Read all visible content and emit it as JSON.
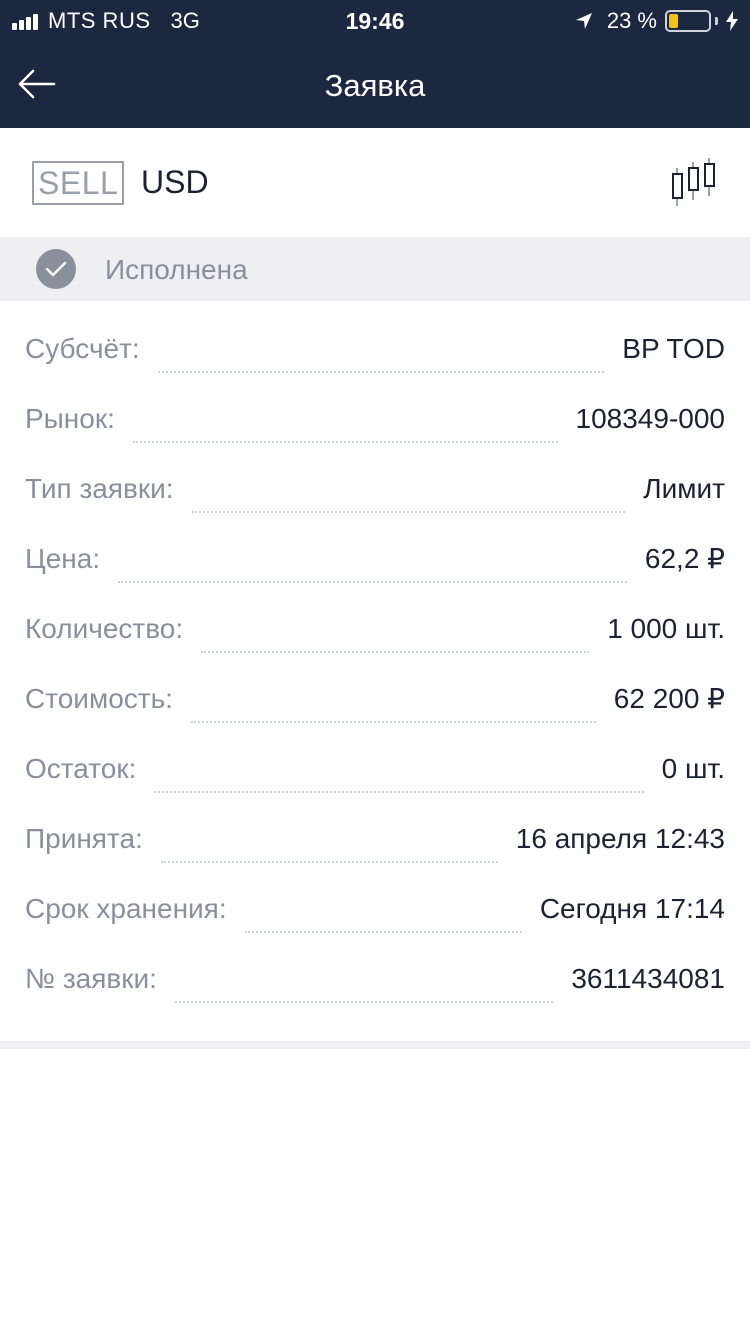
{
  "status_bar": {
    "carrier": "MTS RUS",
    "network": "3G",
    "time": "19:46",
    "battery_percent": "23 %",
    "battery_level": 0.23,
    "battery_color": "#f2c21a"
  },
  "header": {
    "title": "Заявка",
    "back_icon": "arrow-left-icon",
    "background": "#1b2840"
  },
  "instrument": {
    "side": "SELL",
    "name": "USD",
    "chart_icon": "candlestick-chart-icon"
  },
  "order_status": {
    "text": "Исполнена",
    "icon": "check-circle-icon"
  },
  "details": [
    {
      "label": "Субсчёт:",
      "value": "BP TOD"
    },
    {
      "label": "Рынок:",
      "value": "108349-000"
    },
    {
      "label": "Тип заявки:",
      "value": "Лимит"
    },
    {
      "label": "Цена:",
      "value": "62,2 ₽"
    },
    {
      "label": "Количество:",
      "value": "1 000 шт."
    },
    {
      "label": "Стоимость:",
      "value": "62 200 ₽"
    },
    {
      "label": "Остаток:",
      "value": "0 шт."
    },
    {
      "label": "Принята:",
      "value": "16 апреля 12:43"
    },
    {
      "label": "Срок хранения:",
      "value": "Сегодня 17:14"
    },
    {
      "label": "№ заявки:",
      "value": "3611434081"
    }
  ]
}
